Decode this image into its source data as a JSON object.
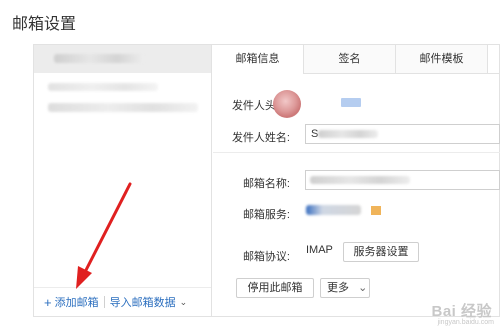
{
  "page": {
    "title": "邮箱设置"
  },
  "accounts": {
    "footer": {
      "add_label": "添加邮箱",
      "add_icon": "+",
      "import_label": "导入邮箱数据",
      "import_chevron": "⌄"
    }
  },
  "tabs": [
    {
      "label": "邮箱信息",
      "active": true
    },
    {
      "label": "签名",
      "active": false
    },
    {
      "label": "邮件模板",
      "active": false
    }
  ],
  "form": {
    "avatar_label": "发件人头像:",
    "sender_name_label": "发件人姓名:",
    "sender_name_value": "S",
    "mailbox_name_label": "邮箱名称:",
    "mailbox_service_label": "邮箱服务:",
    "protocol_label": "邮箱协议:",
    "protocol_value": "IMAP",
    "server_settings_button": "服务器设置",
    "disable_button": "停用此邮箱",
    "more_button": "更多",
    "more_chevron": "⌄"
  },
  "annotation": {
    "arrow_color": "#e02020"
  },
  "watermark": {
    "text": "Bai 经验",
    "sub": "jingyan.baidu.com"
  }
}
